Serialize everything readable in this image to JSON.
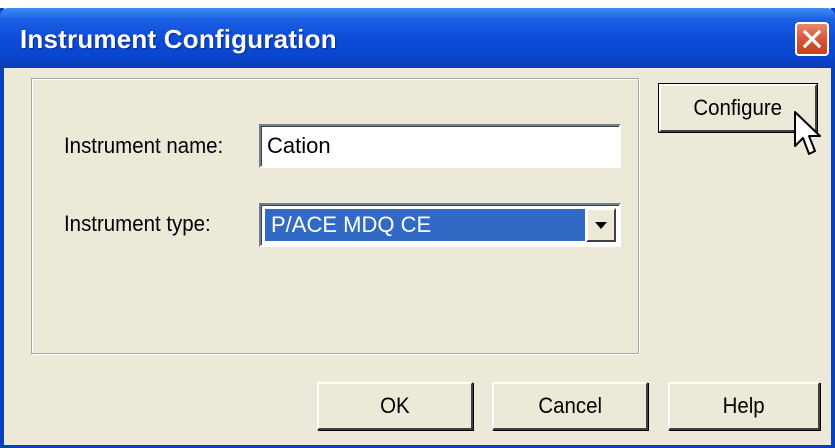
{
  "window": {
    "title": "Instrument Configuration",
    "close_icon": "close-x-icon",
    "accent_color": "#0a46cf",
    "close_color": "#d9583c"
  },
  "form": {
    "name_label": "Instrument name:",
    "name_value": "Cation",
    "type_label": "Instrument type:",
    "type_value": "P/ACE MDQ CE",
    "dropdown_icon": "chevron-down-icon"
  },
  "buttons": {
    "configure": "Configure",
    "ok": "OK",
    "cancel": "Cancel",
    "help": "Help"
  },
  "cursor_icon": "mouse-pointer-icon"
}
